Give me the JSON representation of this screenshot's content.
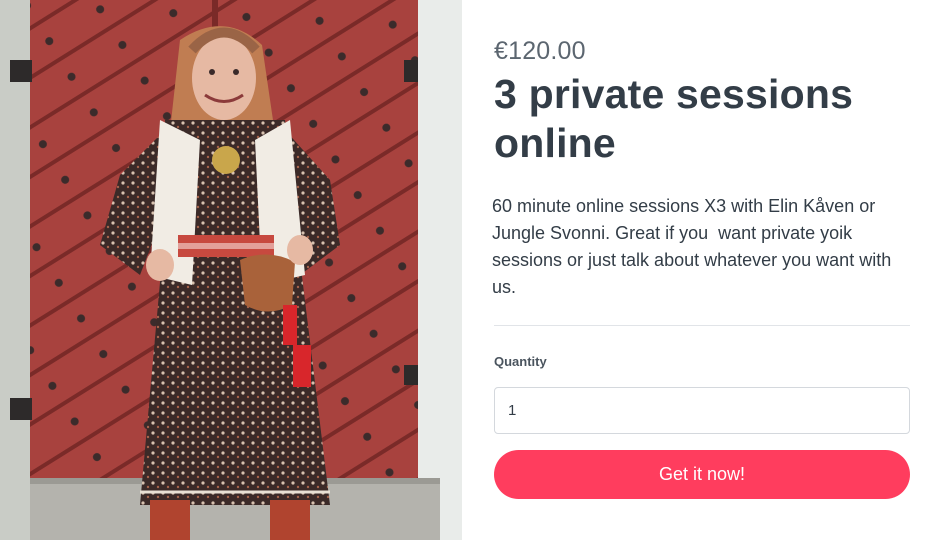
{
  "product": {
    "price": "€120.00",
    "title": "3 private sessions online",
    "description": "60 minute online sessions X3 with Elin Kåven or Jungle Svonni. Great if you  want private yoik sessions or just talk about whatever you want with us."
  },
  "form": {
    "quantity_label": "Quantity",
    "quantity_value": "1",
    "buy_label": "Get it now!"
  },
  "colors": {
    "button": "#ff3d5e",
    "title": "#333d47",
    "price": "#5c6670",
    "door": "#a3403c"
  }
}
